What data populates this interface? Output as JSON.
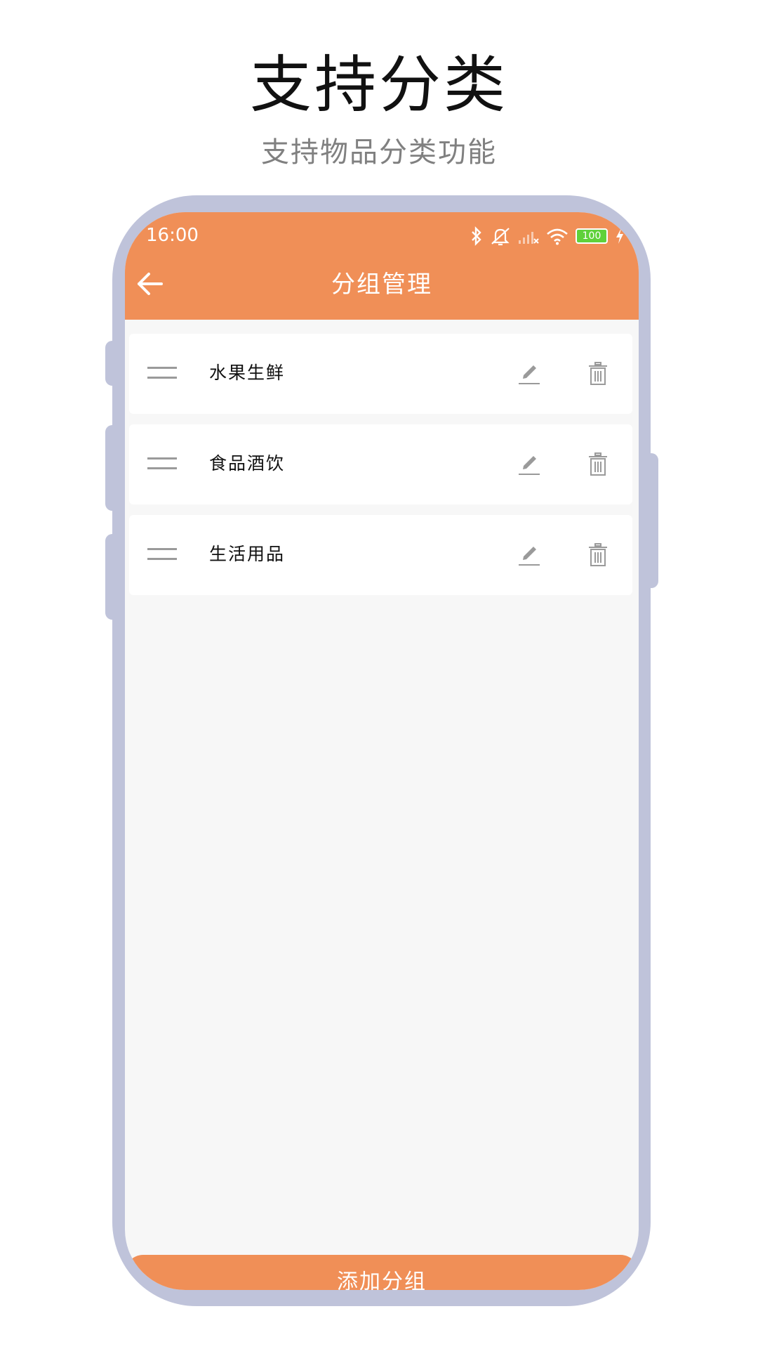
{
  "promo": {
    "title": "支持分类",
    "subtitle": "支持物品分类功能"
  },
  "status_bar": {
    "time": "16:00",
    "battery_level": "100",
    "icons": [
      "bluetooth-icon",
      "mute-icon",
      "signal-icon",
      "wifi-icon",
      "battery-icon",
      "charging-icon"
    ]
  },
  "app_bar": {
    "title": "分组管理",
    "back_icon": "arrow-left-icon"
  },
  "groups": [
    {
      "label": "水果生鲜"
    },
    {
      "label": "食品酒饮"
    },
    {
      "label": "生活用品"
    }
  ],
  "actions": {
    "add_group_label": "添加分组"
  },
  "colors": {
    "accent": "#f08f57",
    "frame": "#bfc3da",
    "background": "#f7f7f7"
  }
}
